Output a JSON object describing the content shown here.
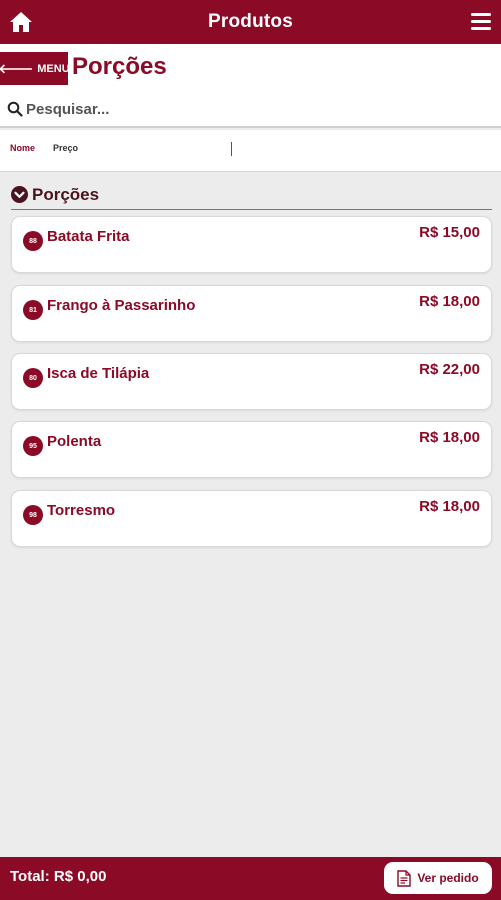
{
  "header": {
    "title": "Produtos",
    "home_icon": "home-icon",
    "menu_icon": "hamburger-menu-icon"
  },
  "subheader": {
    "menu_button_label": "MENU",
    "page_title": "Porções"
  },
  "search": {
    "placeholder": "Pesquisar..."
  },
  "columns": {
    "name": "Nome",
    "price": "Preço"
  },
  "section": {
    "title": "Porções",
    "icon": "chevron-down-circle-icon"
  },
  "products": [
    {
      "code": "88",
      "name": "Batata Frita",
      "price": "R$ 15,00"
    },
    {
      "code": "81",
      "name": "Frango à Passarinho",
      "price": "R$ 18,00"
    },
    {
      "code": "80",
      "name": "Isca de Tilápia",
      "price": "R$ 22,00"
    },
    {
      "code": "95",
      "name": "Polenta",
      "price": "R$ 18,00"
    },
    {
      "code": "98",
      "name": "Torresmo",
      "price": "R$ 18,00"
    }
  ],
  "footer": {
    "total": "Total: R$ 0,00",
    "order_button_label": "Ver pedido"
  },
  "colors": {
    "brand": "#8b0a26",
    "background": "#ececec"
  }
}
